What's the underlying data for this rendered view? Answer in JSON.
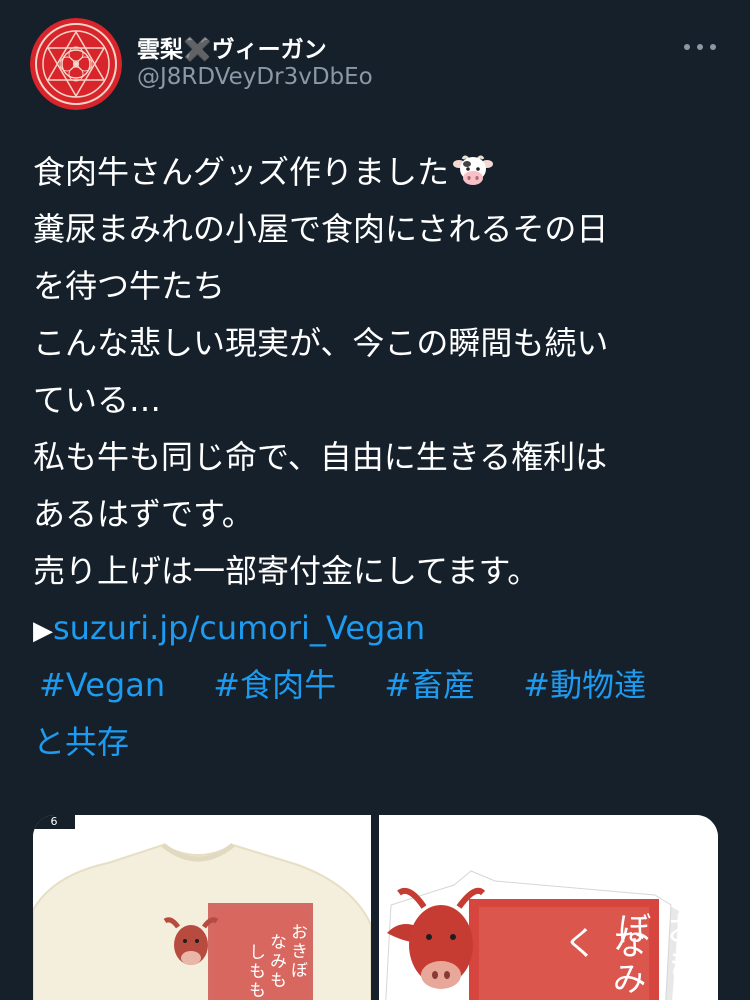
{
  "author": {
    "display_name": "雲梨✖️ヴィーガン",
    "handle": "@J8RDVeyDr3vDbEo"
  },
  "tweet": {
    "lines": [
      "食肉牛さんグッズ作りました",
      "糞尿まみれの小屋で食肉にされるその日",
      "を待つ牛たち",
      "こんな悲しい現実が、今この瞬間も続い",
      "ている…",
      "私も牛も同じ命で、自由に生きる権利は",
      "あるはずです。",
      "売り上げは一部寄付金にしてます。"
    ],
    "link_arrow": "▶",
    "link": "suzuri.jp/cumori_Vegan",
    "hashtags": [
      "#Vegan",
      "#食肉牛",
      "#畜産",
      "#動物達",
      "と共存"
    ]
  },
  "media": {
    "left_badge": "6",
    "left_text": [
      "おきぼ",
      "なみも",
      "しもも"
    ],
    "right_text": [
      "おきぼ",
      "なみく"
    ]
  },
  "colors": {
    "background": "#15202b",
    "link": "#1d9bf0",
    "secondary": "#8b98a5",
    "avatar_red": "#d8252b"
  },
  "icons": {
    "more": "more-horizontal-icon",
    "cow": "cow-face-emoji"
  }
}
